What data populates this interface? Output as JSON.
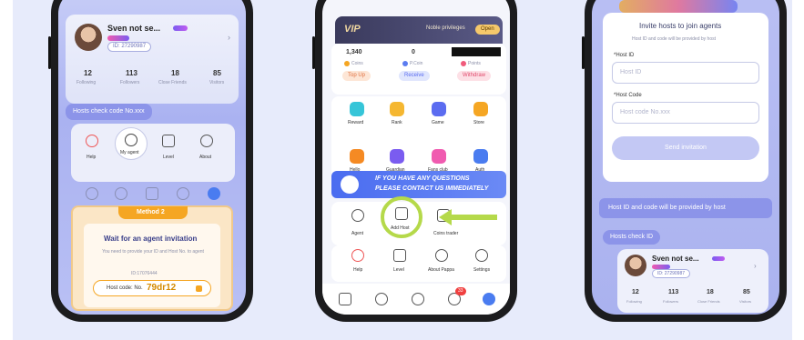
{
  "phone1": {
    "profile": {
      "name": "Sven not se...",
      "id": "ID: 27290987"
    },
    "stats": [
      {
        "value": "12",
        "label": "Following"
      },
      {
        "value": "113",
        "label": "Followers"
      },
      {
        "value": "18",
        "label": "Close Friends"
      },
      {
        "value": "85",
        "label": "Visitors"
      }
    ],
    "hosts_chip": "Hosts check code No.xxx",
    "menu": [
      {
        "label": "Help",
        "icon": "help-icon"
      },
      {
        "label": "My agent",
        "icon": "agent-icon"
      },
      {
        "label": "Level",
        "icon": "crown-icon"
      },
      {
        "label": "About",
        "icon": "info-icon"
      }
    ],
    "method": {
      "title": "Method 2",
      "heading": "Wait for an agent invitation",
      "desc": "You need to provide your ID and Host No. to agent",
      "small_id": "ID:17076444",
      "host_code_prefix": "Host code: No.",
      "host_code": "79dr12"
    }
  },
  "phone2": {
    "banner": {
      "vip": "VIP",
      "label": "Noble privileges",
      "btn": "Open"
    },
    "wallet": [
      {
        "value": "1,340",
        "label": "Coins",
        "btn": "Top Up",
        "color": "#f5a623"
      },
      {
        "value": "0",
        "label": "P.Coin",
        "btn": "Receive",
        "color": "#5b7cf0"
      },
      {
        "value": "",
        "label": "Points",
        "btn": "Withdraw",
        "color": "#f05b7c"
      }
    ],
    "grid_row1": [
      {
        "label": "Reward",
        "icon": "reward-icon",
        "color": "#36c5d8"
      },
      {
        "label": "Rank",
        "icon": "trophy-icon",
        "color": "#f5b731"
      },
      {
        "label": "Game",
        "icon": "gamepad-icon",
        "color": "#5b6cf0"
      },
      {
        "label": "Store",
        "icon": "bag-icon",
        "color": "#f5a623"
      }
    ],
    "grid_row2": [
      {
        "label": "Hello",
        "icon": "hello-icon",
        "color": "#f58a23"
      },
      {
        "label": "Guardian",
        "icon": "shield-icon",
        "color": "#7a5cf0"
      },
      {
        "label": "Fans club",
        "icon": "fans-icon",
        "color": "#f05bb0"
      },
      {
        "label": "Auth",
        "icon": "auth-icon",
        "color": "#4a7cf0"
      }
    ],
    "question_banner": {
      "line1": "IF YOU HAVE ANY QUESTIONS",
      "line2": "PLEASE CONTACT US IMMEDIATELY"
    },
    "agent_row": [
      {
        "label": "Agent",
        "icon": "person-icon"
      },
      {
        "label": "Add Host",
        "icon": "add-host-icon"
      },
      {
        "label": "Coins trader",
        "icon": "coins-trader-icon"
      }
    ],
    "bottom_row": [
      {
        "label": "Help",
        "icon": "help-icon"
      },
      {
        "label": "Level",
        "icon": "crown-icon"
      },
      {
        "label": "About Pappa",
        "icon": "info-icon"
      },
      {
        "label": "Settings",
        "icon": "gear-icon"
      }
    ],
    "notify_badge": "33"
  },
  "phone3": {
    "title": "Invite hosts to join agents",
    "subtitle": "Host ID and code will be provided by host",
    "field1": {
      "label": "*Host ID",
      "placeholder": "Host ID"
    },
    "field2": {
      "label": "*Host Code",
      "placeholder": "Host code No.xxx"
    },
    "send_btn": "Send invitation",
    "info_bar": "Host ID and code will be provided by host",
    "hosts_chip": "Hosts check ID",
    "profile": {
      "name": "Sven not se...",
      "id": "ID: 27290987"
    },
    "stats": [
      {
        "value": "12",
        "label": "Following"
      },
      {
        "value": "113",
        "label": "Followers"
      },
      {
        "value": "18",
        "label": "Close Friends"
      },
      {
        "value": "85",
        "label": "Visitors"
      }
    ]
  }
}
